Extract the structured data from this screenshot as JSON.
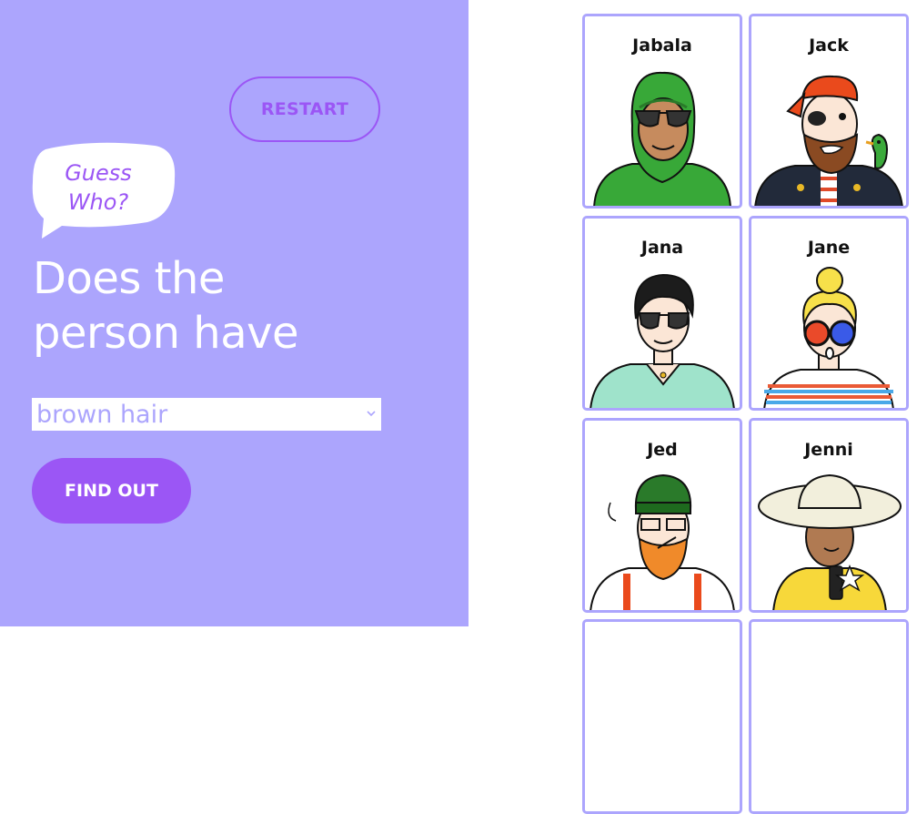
{
  "controls": {
    "restart_label": "RESTART",
    "speech_bubble_line1": "Guess",
    "speech_bubble_line2": "Who?",
    "question_line1": "Does the",
    "question_line2": "person have",
    "select_value": "brown hair",
    "find_out_label": "FIND OUT"
  },
  "board": {
    "cards": [
      {
        "name": "Jabala"
      },
      {
        "name": "Jack"
      },
      {
        "name": "Jana"
      },
      {
        "name": "Jane"
      },
      {
        "name": "Jed"
      },
      {
        "name": "Jenni"
      }
    ]
  },
  "colors": {
    "panel": "#aca5fd",
    "accent": "#9b56f5",
    "card_border": "#aca5fd"
  }
}
